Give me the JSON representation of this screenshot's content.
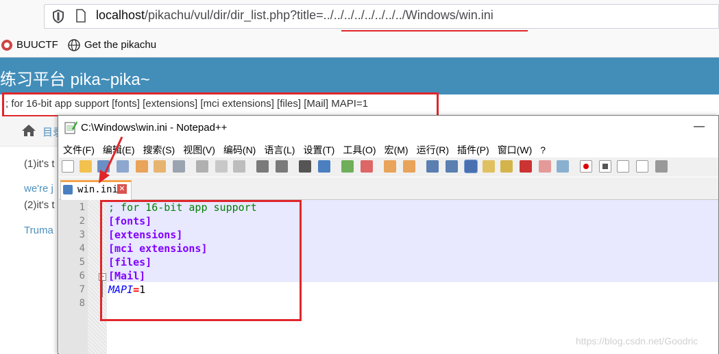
{
  "browser": {
    "url_host": "localhost",
    "url_path": "/pikachu/vul/dir/dir_list.php?title=../../../../../../../../Windows/win.ini",
    "bookmarks": [
      "BUUCTF",
      "Get the pikachu"
    ]
  },
  "page": {
    "banner_title": "练习平台 pika~pika~",
    "output_text": "; for 16-bit app support [fonts] [extensions] [mci extensions] [files] [Mail] MAPI=1",
    "breadcrumb": "目录",
    "lines": [
      "(1)it's t",
      "we're j",
      "(2)it's t",
      "Truma"
    ]
  },
  "notepad": {
    "title": "C:\\Windows\\win.ini - Notepad++",
    "minimize": "—",
    "menus": [
      "文件(F)",
      "编辑(E)",
      "搜索(S)",
      "视图(V)",
      "编码(N)",
      "语言(L)",
      "设置(T)",
      "工具(O)",
      "宏(M)",
      "运行(R)",
      "插件(P)",
      "窗口(W)",
      "?"
    ],
    "tab_label": "win.ini",
    "line_numbers": [
      "1",
      "2",
      "3",
      "4",
      "5",
      "6",
      "7",
      "8"
    ],
    "code": {
      "comment": "; for 16-bit app support",
      "sections": [
        "[fonts]",
        "[extensions]",
        "[mci extensions]",
        "[files]",
        "[Mail]"
      ],
      "key": "MAPI",
      "eq": "=",
      "value": "1"
    }
  },
  "watermark": "https://blog.csdn.net/Goodric",
  "colors": {
    "annotation_red": "#e0262a",
    "banner": "#438eb9",
    "section": "#8000ff",
    "comment": "#008000",
    "key": "#0000ff"
  }
}
